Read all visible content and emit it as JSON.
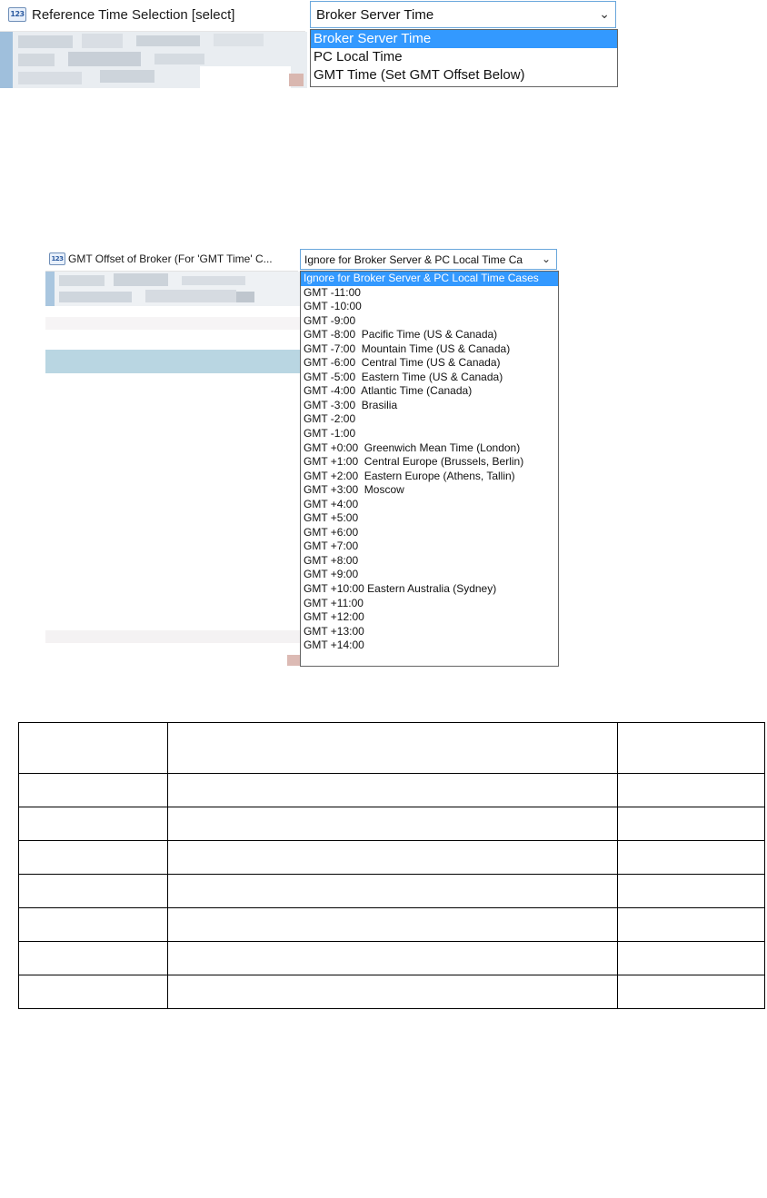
{
  "panel1": {
    "property_icon": "numeric-property-icon",
    "label": "Reference Time Selection [select]",
    "selected_value": "Broker Server Time",
    "arrow_icon": "chevron-down-icon",
    "options": [
      {
        "label": "Broker Server Time",
        "selected": true
      },
      {
        "label": "PC Local Time",
        "selected": false
      },
      {
        "label": "GMT Time (Set GMT Offset Below)",
        "selected": false
      }
    ]
  },
  "panel2": {
    "property_icon": "numeric-property-icon",
    "label": "GMT Offset of Broker (For 'GMT Time' C...",
    "selected_value": "Ignore for Broker Server & PC Local Time Ca",
    "arrow_icon": "chevron-down-icon",
    "options": [
      {
        "label": "Ignore for Broker Server & PC Local Time Cases",
        "selected": true
      },
      {
        "label": "GMT -11:00"
      },
      {
        "label": "GMT -10:00"
      },
      {
        "label": "GMT -9:00"
      },
      {
        "label": "GMT -8:00  Pacific Time (US & Canada)"
      },
      {
        "label": "GMT -7:00  Mountain Time (US & Canada)"
      },
      {
        "label": "GMT -6:00  Central Time (US & Canada)"
      },
      {
        "label": "GMT -5:00  Eastern Time (US & Canada)"
      },
      {
        "label": "GMT -4:00  Atlantic Time (Canada)"
      },
      {
        "label": "GMT -3:00  Brasilia"
      },
      {
        "label": "GMT -2:00"
      },
      {
        "label": "GMT -1:00"
      },
      {
        "label": "GMT +0:00  Greenwich Mean Time (London)"
      },
      {
        "label": "GMT +1:00  Central Europe (Brussels, Berlin)"
      },
      {
        "label": "GMT +2:00  Eastern Europe (Athens, Tallin)"
      },
      {
        "label": "GMT +3:00  Moscow"
      },
      {
        "label": "GMT +4:00"
      },
      {
        "label": "GMT +5:00"
      },
      {
        "label": "GMT +6:00"
      },
      {
        "label": "GMT +7:00"
      },
      {
        "label": "GMT +8:00"
      },
      {
        "label": "GMT +9:00"
      },
      {
        "label": "GMT +10:00 Eastern Australia (Sydney)"
      },
      {
        "label": "GMT +11:00"
      },
      {
        "label": "GMT +12:00"
      },
      {
        "label": "GMT +13:00"
      },
      {
        "label": "GMT +14:00"
      }
    ]
  },
  "empty_table": {
    "columns": 3,
    "rows": [
      "",
      "",
      "",
      "",
      "",
      "",
      "",
      ""
    ]
  }
}
